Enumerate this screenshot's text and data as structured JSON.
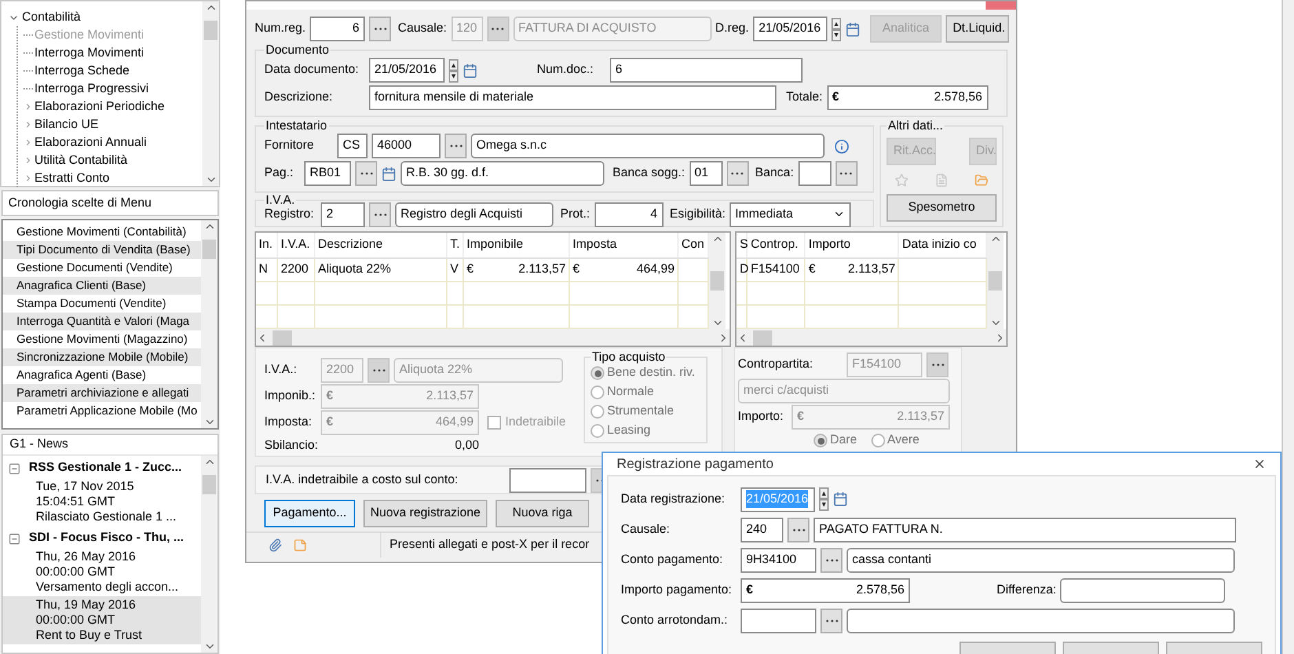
{
  "navigation_tree": {
    "items": [
      {
        "label": "Contabilità",
        "expanded": true,
        "children": [
          {
            "label": "Gestione Movimenti",
            "kind": "leaf",
            "selected": true
          },
          {
            "label": "Interroga Movimenti",
            "kind": "leaf",
            "selected": false
          },
          {
            "label": "Interroga Schede",
            "kind": "leaf",
            "selected": false
          },
          {
            "label": "Interroga Progressivi",
            "kind": "leaf",
            "selected": false
          },
          {
            "label": "Elaborazioni Periodiche",
            "kind": "folder",
            "selected": false
          },
          {
            "label": "Bilancio UE",
            "kind": "folder",
            "selected": false
          },
          {
            "label": "Elaborazioni Annuali",
            "kind": "folder",
            "selected": false
          },
          {
            "label": "Utilità Contabilità",
            "kind": "folder",
            "selected": false
          },
          {
            "label": "Estratti Conto",
            "kind": "folder",
            "selected": false
          }
        ]
      }
    ]
  },
  "menu_history": {
    "title": "Cronologia scelte di Menu",
    "items": [
      "Gestione Movimenti (Contabilità)",
      "Tipi Documento di Vendita (Base)",
      "Gestione Documenti (Vendite)",
      "Anagrafica Clienti (Base)",
      "Stampa Documenti (Vendite)",
      "Interroga Quantità e Valori (Maga",
      "Gestione Movimenti (Magazzino)",
      "Sincronizzazione Mobile (Mobile)",
      "Anagrafica Agenti (Base)",
      "Parametri archiviazione e allegati",
      "Parametri Applicazione Mobile (Mo"
    ]
  },
  "news": {
    "title": "G1 - News",
    "feeds": [
      {
        "title": "RSS Gestionale 1 - Zucc...",
        "expanded": true,
        "entries": [
          {
            "date": "Tue, 17 Nov 2015",
            "time": "15:04:51 GMT",
            "summary": "Rilasciato Gestionale 1 ...",
            "selected": false
          }
        ]
      },
      {
        "title": "SDI - Focus Fisco - Thu, ...",
        "expanded": true,
        "entries": [
          {
            "date": "Thu, 26 May 2016",
            "time": "00:00:00 GMT",
            "summary": "Versamento degli accon...",
            "selected": false
          },
          {
            "date": "Thu, 19 May 2016",
            "time": "00:00:00 GMT",
            "summary": "Rent to Buy e Trust",
            "selected": true
          }
        ]
      }
    ]
  },
  "header": {
    "num_reg_label": "Num.reg.",
    "num_reg": "6",
    "causale_label": "Causale:",
    "causale_code": "120",
    "causale_desc": "FATTURA DI ACQUISTO",
    "causale_disabled": true,
    "dreg_label": "D.reg.",
    "dreg": "21/05/2016",
    "buttons": [
      {
        "label": "Analitica",
        "disabled": true
      },
      {
        "label": "Dt.Liquid.",
        "disabled": false
      }
    ]
  },
  "documento": {
    "title": "Documento",
    "data_label": "Data documento:",
    "data": "21/05/2016",
    "numdoc_label": "Num.doc.:",
    "numdoc": "6",
    "descr_label": "Descrizione:",
    "descr": "fornitura mensile di materiale",
    "totale_label": "Totale:",
    "currency": "€",
    "totale": "2.578,56"
  },
  "intestatario": {
    "title": "Intestatario",
    "fornitore_label": "Fornitore",
    "tipo": "CS",
    "codice": "46000",
    "nome": "Omega s.n.c",
    "pag_label": "Pag.:",
    "pag_code": "RB01",
    "pag_desc": "R.B. 30 gg. d.f.",
    "banca_sogg_label": "Banca sogg.:",
    "banca_sogg": "01",
    "banca_label": "Banca:"
  },
  "iva": {
    "title": "I.V.A.",
    "registro_label": "Registro:",
    "registro": "2",
    "registro_desc": "Registro degli Acquisti",
    "prot_label": "Prot.:",
    "prot": "4",
    "esig_label": "Esigibilità:",
    "esig": "Immediata"
  },
  "altri_dati": {
    "title": "Altri dati...",
    "buttons": [
      {
        "label": "Rit.Acc.",
        "disabled": true
      },
      {
        "label": "Div.",
        "disabled": true
      }
    ],
    "spesometro": "Spesometro"
  },
  "iva_table": {
    "columns": [
      "In.",
      "I.V.A.",
      "Descrizione",
      "T.",
      "Imponibile",
      "Imposta",
      "Con"
    ],
    "rows": [
      {
        "cells": [
          {
            "text": "N"
          },
          {
            "text": "2200"
          },
          {
            "text": "Aliquota 22%"
          },
          {
            "text": "V"
          },
          {
            "currency": "€",
            "text": "2.113,57"
          },
          {
            "currency": "€",
            "text": "464,99"
          }
        ]
      }
    ]
  },
  "contropartite_table": {
    "columns": [
      "S",
      "Controp.",
      "Importo",
      "Data inizio co"
    ],
    "rows": [
      {
        "cells": [
          {
            "text": "D"
          },
          {
            "text": "F154100"
          },
          {
            "currency": "€",
            "text": "2.113,57"
          }
        ]
      }
    ]
  },
  "iva_detail": {
    "disabled": true,
    "iva_label": "I.V.A.:",
    "iva_code": "2200",
    "iva_desc": "Aliquota 22%",
    "imponib_label": "Imponib.:",
    "imponib_currency": "€",
    "imponib": "2.113,57",
    "imposta_label": "Imposta:",
    "imposta_currency": "€",
    "imposta": "464,99",
    "indetraibile": {
      "label": "Indetraibile",
      "checked": false
    },
    "sbilancio_label": "Sbilancio:",
    "sbilancio": "0,00"
  },
  "tipo_acquisto": {
    "title": "Tipo acquisto",
    "options": [
      {
        "label": "Bene destin. riv.",
        "selected": true
      },
      {
        "label": "Normale",
        "selected": false
      },
      {
        "label": "Strumentale",
        "selected": false
      },
      {
        "label": "Leasing",
        "selected": false
      }
    ]
  },
  "contropartita_detail": {
    "label": "Contropartita:",
    "code": "F154100",
    "desc": "merci c/acquisti",
    "importo_label": "Importo:",
    "currency": "€",
    "importo": "2.113,57",
    "sides": [
      {
        "label": "Dare",
        "selected": true
      },
      {
        "label": "Avere",
        "selected": false
      }
    ]
  },
  "indetraibile_row": {
    "label": "I.V.A. indetraibile a costo sul conto:"
  },
  "action_buttons": [
    {
      "label": "Pagamento...",
      "focused": true
    },
    {
      "label": "Nuova registrazione",
      "focused": false
    },
    {
      "label": "Nuova riga",
      "focused": false
    }
  ],
  "status_bar": {
    "message": "Presenti allegati e post-X per il recor"
  },
  "payment_dialog": {
    "title": "Registrazione pagamento",
    "data_label": "Data registrazione:",
    "data": "21/05/2016",
    "data_highlighted": true,
    "causale_label": "Causale:",
    "causale_code": "240",
    "causale_desc": "PAGATO FATTURA N.",
    "conto_label": "Conto pagamento:",
    "conto_code": "9H34100",
    "conto_desc": "cassa contanti",
    "importo_label": "Importo pagamento:",
    "currency": "€",
    "importo": "2.578,56",
    "differenza_label": "Differenza:",
    "arrot_label": "Conto arrotondam.:"
  }
}
